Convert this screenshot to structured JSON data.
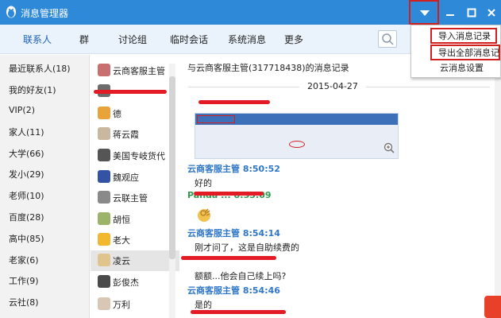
{
  "window": {
    "title": "消息管理器"
  },
  "tabs": [
    {
      "label": "联系人",
      "active": true
    },
    {
      "label": "群"
    },
    {
      "label": "讨论组"
    },
    {
      "label": "临时会话"
    },
    {
      "label": "系统消息"
    },
    {
      "label": "更多"
    }
  ],
  "groups": [
    "最近联系人(18)",
    "我的好友(1)",
    "VIP(2)",
    "家人(11)",
    "大学(66)",
    "发小(29)",
    "老师(10)",
    "百度(28)",
    "高中(85)",
    "老家(6)",
    "工作(9)",
    "云社(8)"
  ],
  "contacts": [
    {
      "name": "云商客服主管",
      "avatar_color": "#c96f6f"
    },
    {
      "name": "",
      "avatar_color": "#6d6d6d"
    },
    {
      "name": "德",
      "avatar_color": "#e8a33b"
    },
    {
      "name": "蒋云霞",
      "avatar_color": "#c9b7a0"
    },
    {
      "name": "美国专岐货代",
      "avatar_color": "#555555"
    },
    {
      "name": "魏观应",
      "avatar_color": "#3553a4"
    },
    {
      "name": "云联主管",
      "avatar_color": "#8a8a8a"
    },
    {
      "name": "胡恒",
      "avatar_color": "#9bb46a"
    },
    {
      "name": "老大",
      "avatar_color": "#f2b830"
    },
    {
      "name": "凌云",
      "avatar_color": "#e0c48c",
      "selected": true
    },
    {
      "name": "彭俊杰",
      "avatar_color": "#4a4a4a"
    },
    {
      "name": "万利",
      "avatar_color": "#d8c7b5"
    }
  ],
  "chat": {
    "header": "与云商客服主管(317718438)的消息记录",
    "date": "2015-04-27",
    "messages": [
      {
        "sender": "云商客服主管 8:50:52",
        "text": "好的"
      },
      {
        "sender": "Panda ... 8:53:09",
        "text": ""
      },
      {
        "sender": "云商客服主管 8:54:14",
        "text": "刚才问了，这是自助续费的"
      },
      {
        "sender": "",
        "text": "额额...他会自己续上吗?"
      },
      {
        "sender": "云商客服主管 8:54:46",
        "text": "是的"
      }
    ]
  },
  "dropdown_menu": [
    {
      "label": "导入消息记录"
    },
    {
      "label": "导出全部消息记录"
    },
    {
      "label": "云消息设置"
    }
  ],
  "colors": {
    "titlebar": "#2e8ad8",
    "accent_blue": "#2f77c8",
    "highlight_red": "#d21f1f"
  }
}
